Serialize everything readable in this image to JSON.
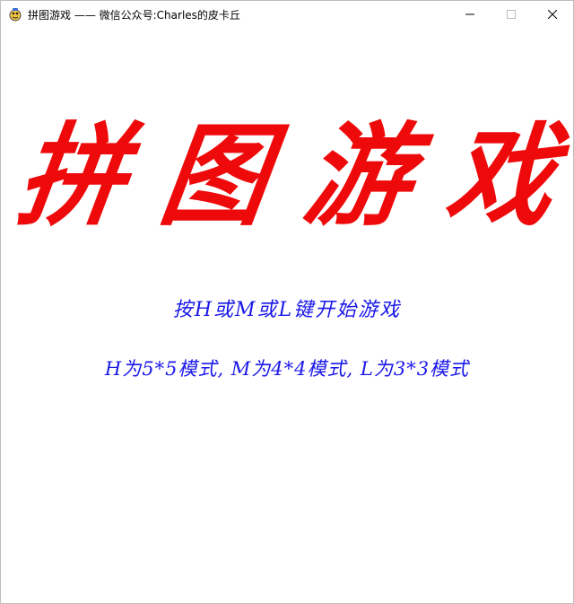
{
  "window": {
    "title": "拼图游戏 —— 微信公众号:Charles的皮卡丘",
    "icon": "pygame-snake-icon",
    "controls": {
      "minimize": "minimize-icon",
      "maximize": "maximize-icon",
      "close": "close-icon"
    }
  },
  "game": {
    "title_chars": [
      "拼",
      "图",
      "游",
      "戏"
    ],
    "instruction": "按H或M或L键开始游戏",
    "modes": "H为5*5模式, M为4*4模式, L为3*3模式"
  },
  "colors": {
    "title": "#ee0a0a",
    "text": "#1a18e8",
    "background": "#ffffff"
  }
}
